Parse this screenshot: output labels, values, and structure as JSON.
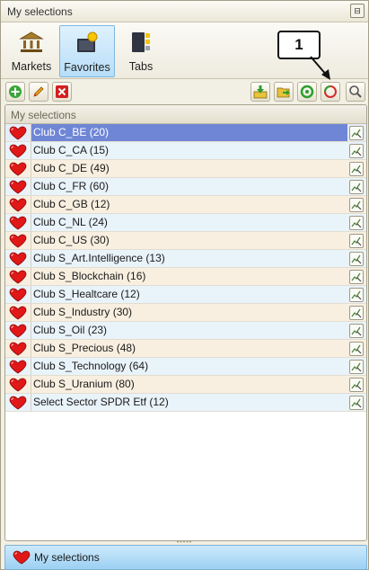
{
  "window": {
    "title": "My selections",
    "pin_icon": "pin-icon"
  },
  "nav": [
    {
      "label": "Markets",
      "icon": "bank-icon",
      "active": false
    },
    {
      "label": "Favorites",
      "icon": "favorites-icon",
      "active": true
    },
    {
      "label": "Tabs",
      "icon": "tabs-icon",
      "active": false
    }
  ],
  "toolbar": {
    "left": [
      "add-icon",
      "edit-icon",
      "delete-icon"
    ],
    "right": [
      "import-icon",
      "folder-export-icon",
      "refresh-green-icon",
      "sync-icon",
      "search-icon"
    ]
  },
  "panel": {
    "header": "My selections"
  },
  "rows": [
    {
      "label": "Club C_BE (20)"
    },
    {
      "label": "Club C_CA (15)"
    },
    {
      "label": "Club C_DE (49)"
    },
    {
      "label": "Club C_FR (60)"
    },
    {
      "label": "Club C_GB (12)"
    },
    {
      "label": "Club C_NL (24)"
    },
    {
      "label": "Club C_US (30)"
    },
    {
      "label": "Club S_Art.Intelligence (13)"
    },
    {
      "label": "Club S_Blockchain (16)"
    },
    {
      "label": "Club S_Healtcare (12)"
    },
    {
      "label": "Club S_Industry (30)"
    },
    {
      "label": "Club S_Oil (23)"
    },
    {
      "label": "Club S_Precious (48)"
    },
    {
      "label": "Club S_Technology (64)"
    },
    {
      "label": "Club S_Uranium (80)"
    },
    {
      "label": "Select Sector SPDR Etf (12)"
    }
  ],
  "selected_index": 0,
  "footer": {
    "label": "My selections"
  },
  "callout": {
    "text": "1"
  },
  "colors": {
    "selection": "#6f86d6",
    "accent": "#9bd0f3",
    "heart": "#e01818"
  }
}
